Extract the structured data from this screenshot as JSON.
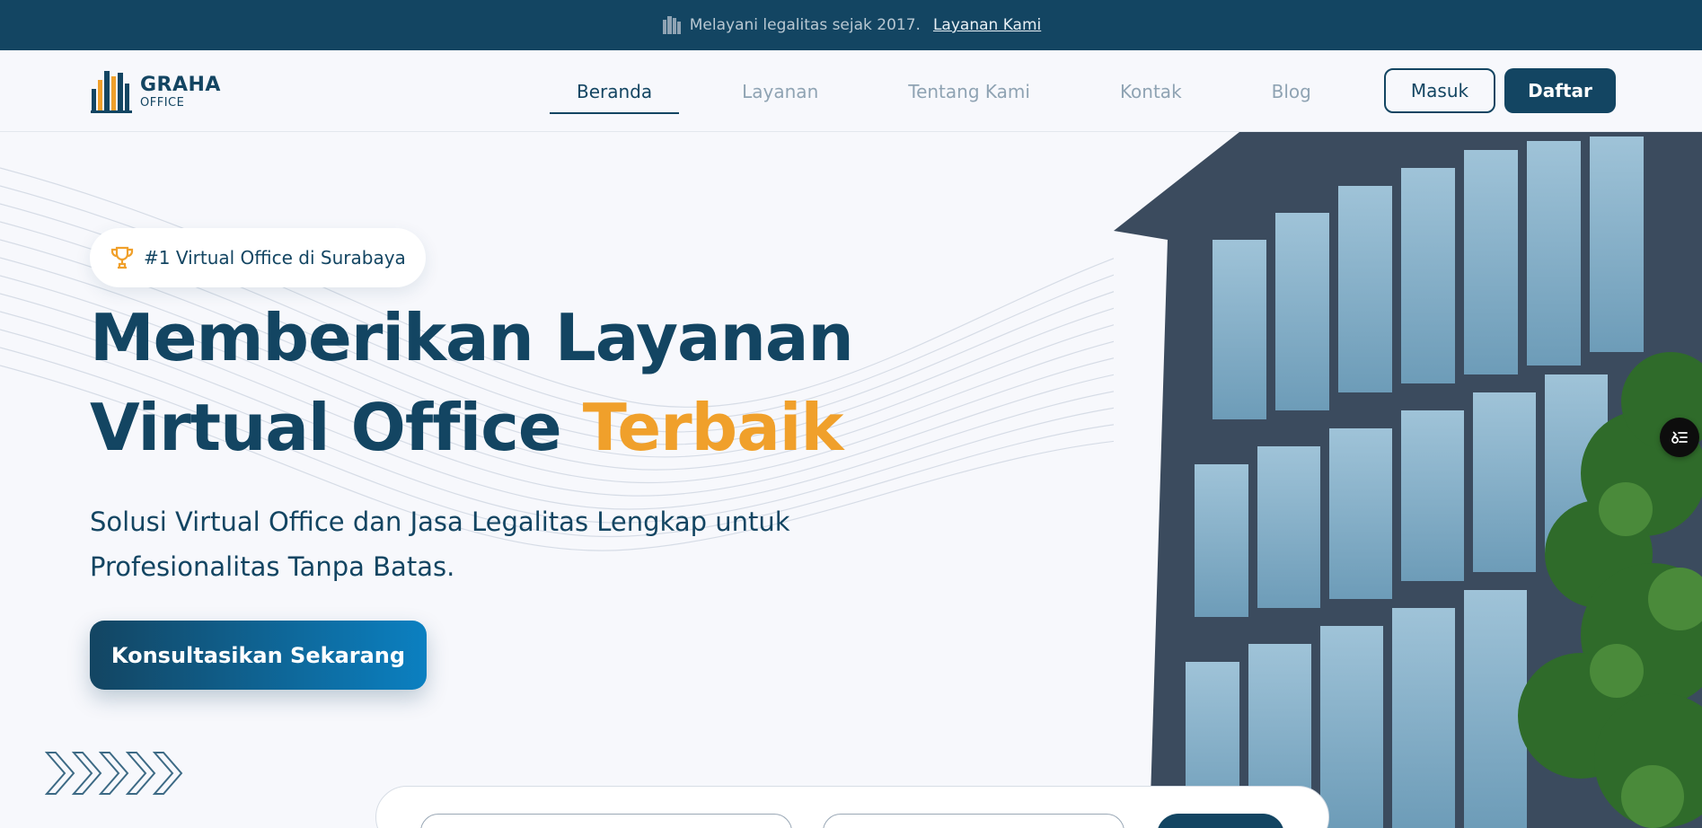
{
  "announcement": {
    "icon": "building-icon",
    "text": "Melayani legalitas sejak 2017.",
    "link_label": "Layanan Kami"
  },
  "logo": {
    "line1": "GRAHA",
    "line2": "OFFICE",
    "icon": "buildings-logo-icon"
  },
  "nav": {
    "items": [
      {
        "label": "Beranda",
        "active": true
      },
      {
        "label": "Layanan",
        "active": false
      },
      {
        "label": "Tentang Kami",
        "active": false
      },
      {
        "label": "Kontak",
        "active": false
      },
      {
        "label": "Blog",
        "active": false
      }
    ],
    "login_label": "Masuk",
    "register_label": "Daftar"
  },
  "hero": {
    "badge": {
      "icon": "trophy-icon",
      "text": "#1 Virtual Office di Surabaya"
    },
    "title_line1": "Memberikan Layanan",
    "title_line2_main": "Virtual Office ",
    "title_line2_accent": "Terbaik",
    "subtitle": "Solusi Virtual Office dan Jasa Legalitas Lengkap untuk Profesionalitas Tanpa Batas.",
    "cta_label": "Konsultasikan Sekarang"
  },
  "colors": {
    "primary": "#134562",
    "accent": "#f0a02b",
    "background": "#f7f8fc",
    "muted_nav": "#8fa3b3"
  }
}
